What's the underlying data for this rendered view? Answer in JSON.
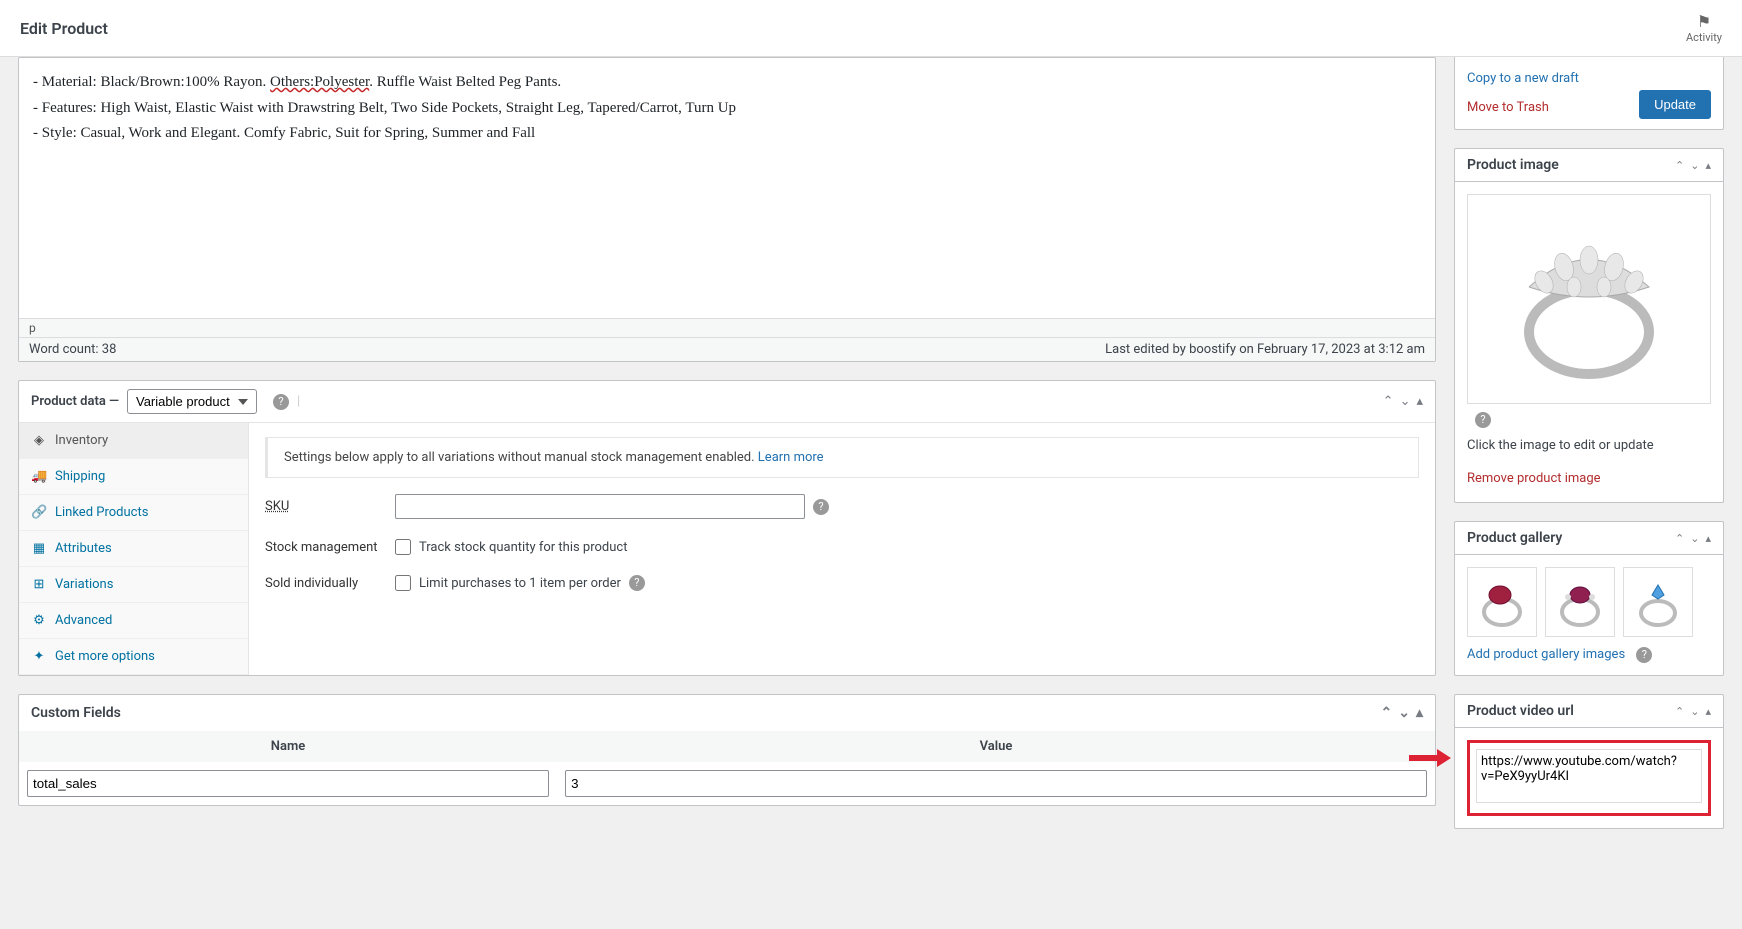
{
  "header": {
    "title": "Edit Product",
    "activity_label": "Activity"
  },
  "editor": {
    "line1_pre": "- Material: Black/Brown:100% Rayon. ",
    "line1_u": "Others:Polyester",
    "line1_post": ". Ruffle Waist Belted Peg Pants.",
    "line2": "- Features: High Waist, Elastic Waist with Drawstring Belt, Two Side Pockets, Straight Leg, Tapered/Carrot, Turn Up",
    "line3": "- Style: Casual, Work and Elegant. Comfy Fabric, Suit for Spring, Summer and Fall",
    "path": "p",
    "wordcount": "Word count: 38",
    "last_edited": "Last edited by boostify on February 17, 2023 at 3:12 am"
  },
  "product_data": {
    "title": "Product data —",
    "select_value": "Variable product",
    "tabs": {
      "inventory": "Inventory",
      "shipping": "Shipping",
      "linked": "Linked Products",
      "attributes": "Attributes",
      "variations": "Variations",
      "advanced": "Advanced",
      "get_more": "Get more options"
    },
    "notice": "Settings below apply to all variations without manual stock management enabled. ",
    "notice_link": "Learn more",
    "sku_label": "SKU",
    "stock_mgmt_label": "Stock management",
    "stock_mgmt_cb": "Track stock quantity for this product",
    "sold_ind_label": "Sold individually",
    "sold_ind_cb": "Limit purchases to 1 item per order"
  },
  "custom_fields": {
    "title": "Custom Fields",
    "col_name": "Name",
    "col_value": "Value",
    "row1_name": "total_sales",
    "row1_value": "3"
  },
  "sidebar": {
    "copy_draft": "Copy to a new draft",
    "move_trash": "Move to Trash",
    "update_btn": "Update",
    "prod_image_title": "Product image",
    "click_edit": "Click the image to edit or update",
    "remove_image": "Remove product image",
    "gallery_title": "Product gallery",
    "add_gallery": "Add product gallery images",
    "video_title": "Product video url",
    "video_value": "https://www.youtube.com/watch?v=PeX9yyUr4KI"
  }
}
